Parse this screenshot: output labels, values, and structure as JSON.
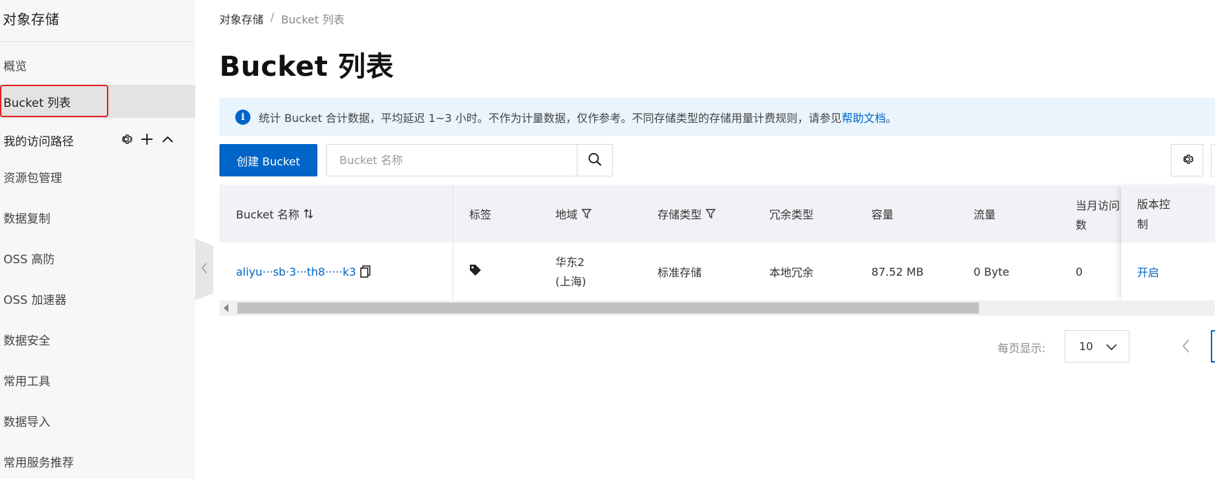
{
  "sidebar": {
    "title": "对象存储",
    "items": [
      {
        "label": "概览"
      },
      {
        "label": "Bucket 列表"
      }
    ],
    "group": {
      "label": "我的访问路径"
    },
    "more_items": [
      {
        "label": "资源包管理"
      },
      {
        "label": "数据复制"
      },
      {
        "label": "OSS 高防"
      },
      {
        "label": "OSS 加速器"
      },
      {
        "label": "数据安全"
      },
      {
        "label": "常用工具"
      },
      {
        "label": "数据导入"
      },
      {
        "label": "常用服务推荐"
      }
    ]
  },
  "breadcrumb": {
    "root": "对象存储",
    "separator": "/",
    "current": "Bucket 列表"
  },
  "page_title": "Bucket 列表",
  "notice": {
    "text": "统计 Bucket 合计数据，平均延迟 1~3 小时。不作为计量数据，仅作参考。不同存储类型的存储用量计费规则，请参见",
    "link": "帮助文档",
    "tail": "。"
  },
  "toolbar": {
    "create_label": "创建 Bucket",
    "search_placeholder": "Bucket 名称"
  },
  "table": {
    "headers": {
      "name": "Bucket 名称",
      "tags": "标签",
      "region": "地域",
      "storage_class": "存储类型",
      "redundancy": "冗余类型",
      "capacity": "容量",
      "traffic": "流量",
      "monthly_access": "当月访问",
      "monthly_access_2": "数",
      "versioning": "版本控",
      "versioning_2": "制"
    },
    "rows": [
      {
        "name": "aliyu···sb·3···th8·····k3",
        "region_1": "华东2",
        "region_2": "(上海)",
        "storage_class": "标准存储",
        "redundancy": "本地冗余",
        "capacity": "87.52 MB",
        "traffic": "0 Byte",
        "monthly_access": "0",
        "versioning": "开启"
      }
    ]
  },
  "pagination": {
    "page_size_label": "每页显示:",
    "page_size": "10"
  },
  "colors": {
    "primary": "#0064c8",
    "notice_bg": "#e9f4fd",
    "highlight": "#e02020"
  }
}
